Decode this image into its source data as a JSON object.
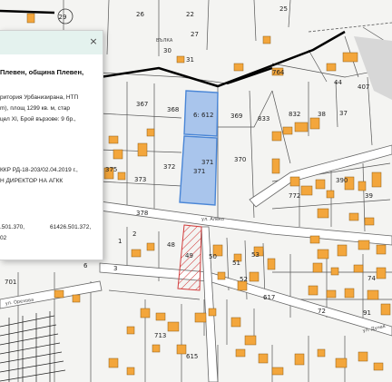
{
  "map": {
    "colors": {
      "background": "#f4f4f2",
      "building": "#f3a63c",
      "building_outline": "#8a5a16",
      "selected_parcel_fill": "#a9c5ec",
      "selected_parcel_outline": "#4a86d6",
      "hatched_parcel": "#d23c3c",
      "main_road": "#000000",
      "parcel_line": "#555555",
      "street_fill": "#ffffff"
    },
    "parcel_labels": {
      "p29": "29",
      "p26": "26",
      "p22": "22",
      "p27": "27",
      "p25": "25",
      "p30": "30",
      "p31": "31",
      "p764": "764",
      "p44": "44",
      "p407": "407",
      "p367": "367",
      "p368": "368",
      "p369": "369",
      "p833": "833",
      "p832": "832",
      "p38": "38",
      "p37": "37",
      "p371": "371",
      "p370": "370",
      "p372": "372",
      "p373": "373",
      "p375": "375",
      "p378": "378",
      "p48": "48",
      "p49": "49",
      "p50": "50",
      "p51": "51",
      "p52": "52",
      "p53": "53",
      "p617": "617",
      "p772": "772",
      "p390": "390",
      "p39": "39",
      "p74": "74",
      "p91": "91",
      "p72": "72",
      "p701": "701",
      "p713": "713",
      "p615": "615",
      "p6": "6",
      "p1": "1",
      "p2": "2",
      "p3": "3"
    },
    "selected_parcel_labels": {
      "upper": "6: 612",
      "lower": "371",
      "lower2": "371"
    },
    "street_labels": {
      "street1": "ул. Алеко",
      "street2": "ул. Дунав",
      "street3": "ул. Орехова"
    },
    "area_label": "ВЪЛКА"
  },
  "popup": {
    "close_icon": "×",
    "title": "Плевен, община Плевен,",
    "lines": [
      "ритория Урбанизирана, НТП",
      "m), площ 1299 кв. м, стар",
      "цел XI, Брой вързове: 9 бр.,",
      "ККР РД-18-203/02.04.2019 г.,",
      "Н ДИРЕКТОР НА АГКК"
    ],
    "coord_left": ".501.370,",
    "coord_right": "61426.501.372,",
    "coord_left2": "02"
  }
}
